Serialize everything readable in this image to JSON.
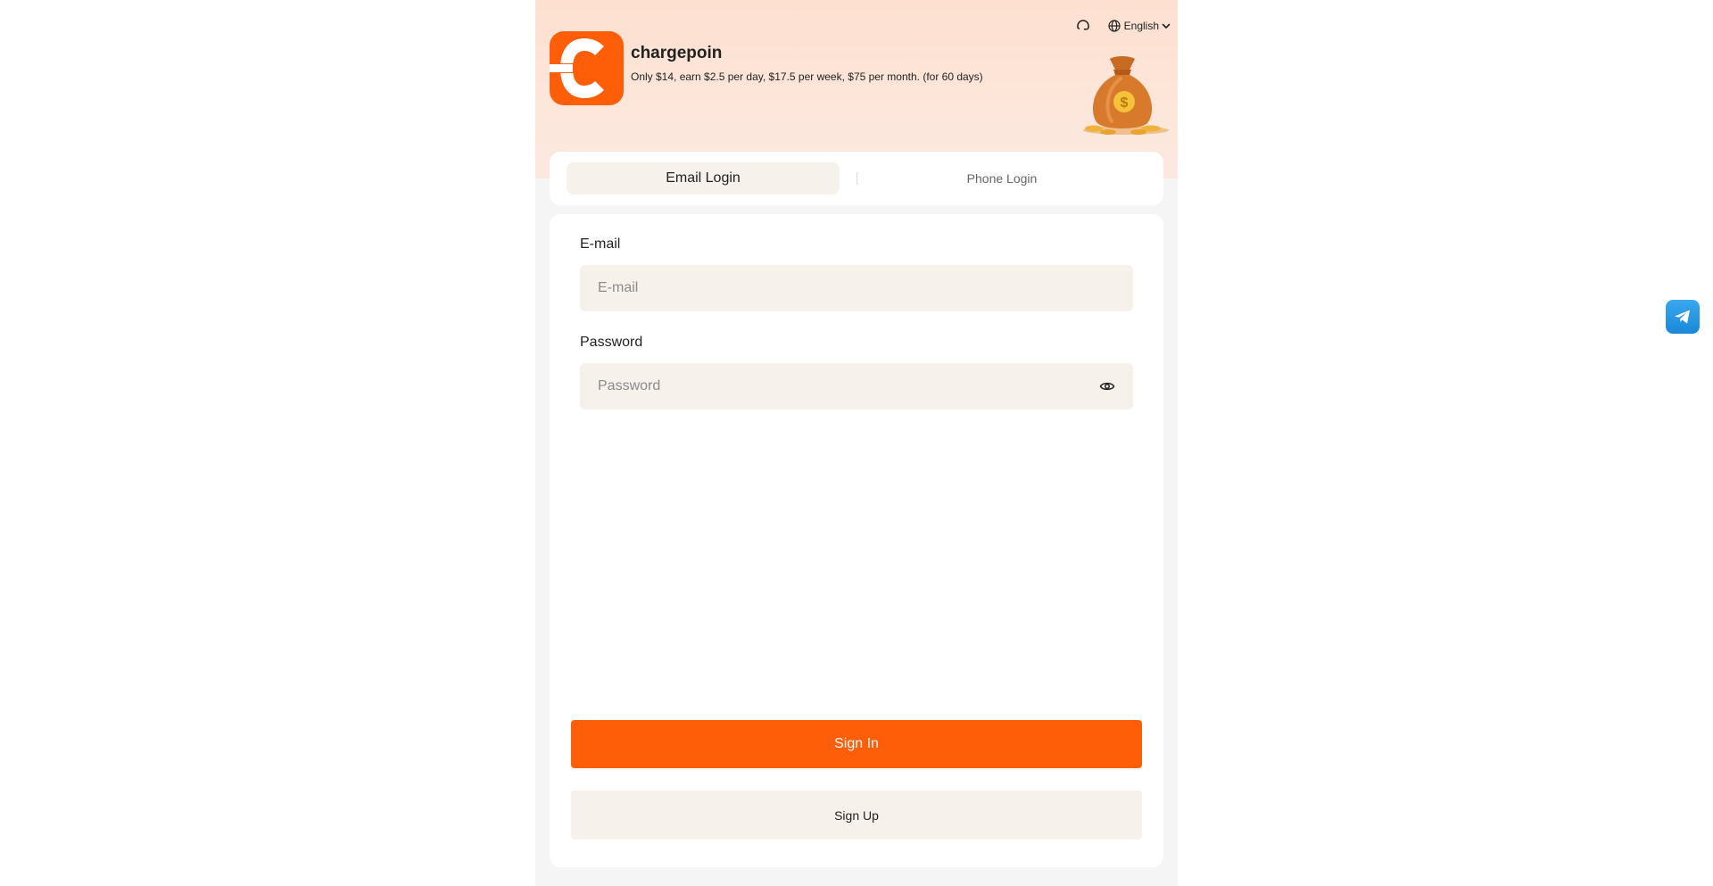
{
  "header": {
    "brand_name": "chargepoin",
    "brand_description": "Only $14, earn $2.5 per day, $17.5 per week, $75 per month. (for 60 days)",
    "language_label": "English",
    "support_icon": "headset-icon",
    "language_icon": "globe-icon"
  },
  "tabs": [
    {
      "label": "Email Login",
      "active": true
    },
    {
      "label": "Phone Login",
      "active": false
    }
  ],
  "form": {
    "email_label": "E-mail",
    "email_placeholder": "E-mail",
    "email_value": "",
    "password_label": "Password",
    "password_placeholder": "Password",
    "password_value": "",
    "password_toggle_icon": "eye-icon"
  },
  "actions": {
    "sign_in_label": "Sign In",
    "sign_up_label": "Sign Up"
  },
  "floating": {
    "telegram_icon": "telegram-icon"
  },
  "colors": {
    "accent": "#fe5e07",
    "field_background": "#f7f1ec",
    "page_background": "#f5f5f5",
    "hero_background": "#fde0d0"
  }
}
